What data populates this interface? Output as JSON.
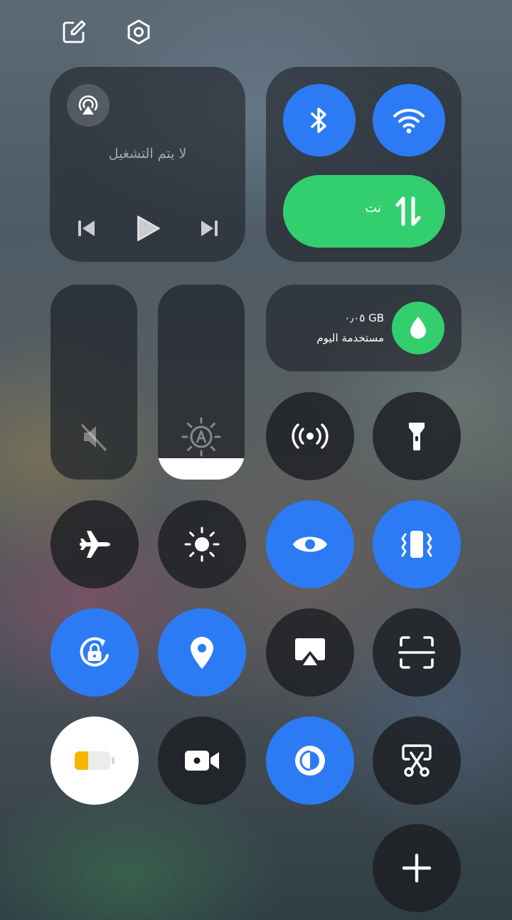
{
  "media": {
    "status": "لا يتم التشغيل"
  },
  "mobile_data": {
    "label": "نت"
  },
  "data_usage": {
    "amount": "٠٫٠٥ GB",
    "caption": "مستخدمة اليوم"
  },
  "brightness_slider": {
    "level": 0.11
  },
  "colors": {
    "active_blue": "#2c7bf4",
    "data_green": "#33cf6f",
    "battery_yellow": "#f7b500"
  },
  "tiles": [
    {
      "icon": "hotspot-icon",
      "state": "off"
    },
    {
      "icon": "flashlight-icon",
      "state": "off"
    },
    {
      "icon": "airplane-icon",
      "state": "off"
    },
    {
      "icon": "brightness-icon",
      "state": "off"
    },
    {
      "icon": "eye-comfort-icon",
      "state": "on"
    },
    {
      "icon": "vibrate-icon",
      "state": "on"
    },
    {
      "icon": "rotation-lock-icon",
      "state": "on"
    },
    {
      "icon": "location-icon",
      "state": "on"
    },
    {
      "icon": "screen-cast-icon",
      "state": "off"
    },
    {
      "icon": "screen-scan-icon",
      "state": "off"
    },
    {
      "icon": "battery-saver-icon",
      "state": "on"
    },
    {
      "icon": "screen-record-icon",
      "state": "off"
    },
    {
      "icon": "dark-mode-icon",
      "state": "on"
    },
    {
      "icon": "screenshot-icon",
      "state": "off"
    },
    {
      "icon": "add-tile-icon",
      "state": "off"
    }
  ]
}
